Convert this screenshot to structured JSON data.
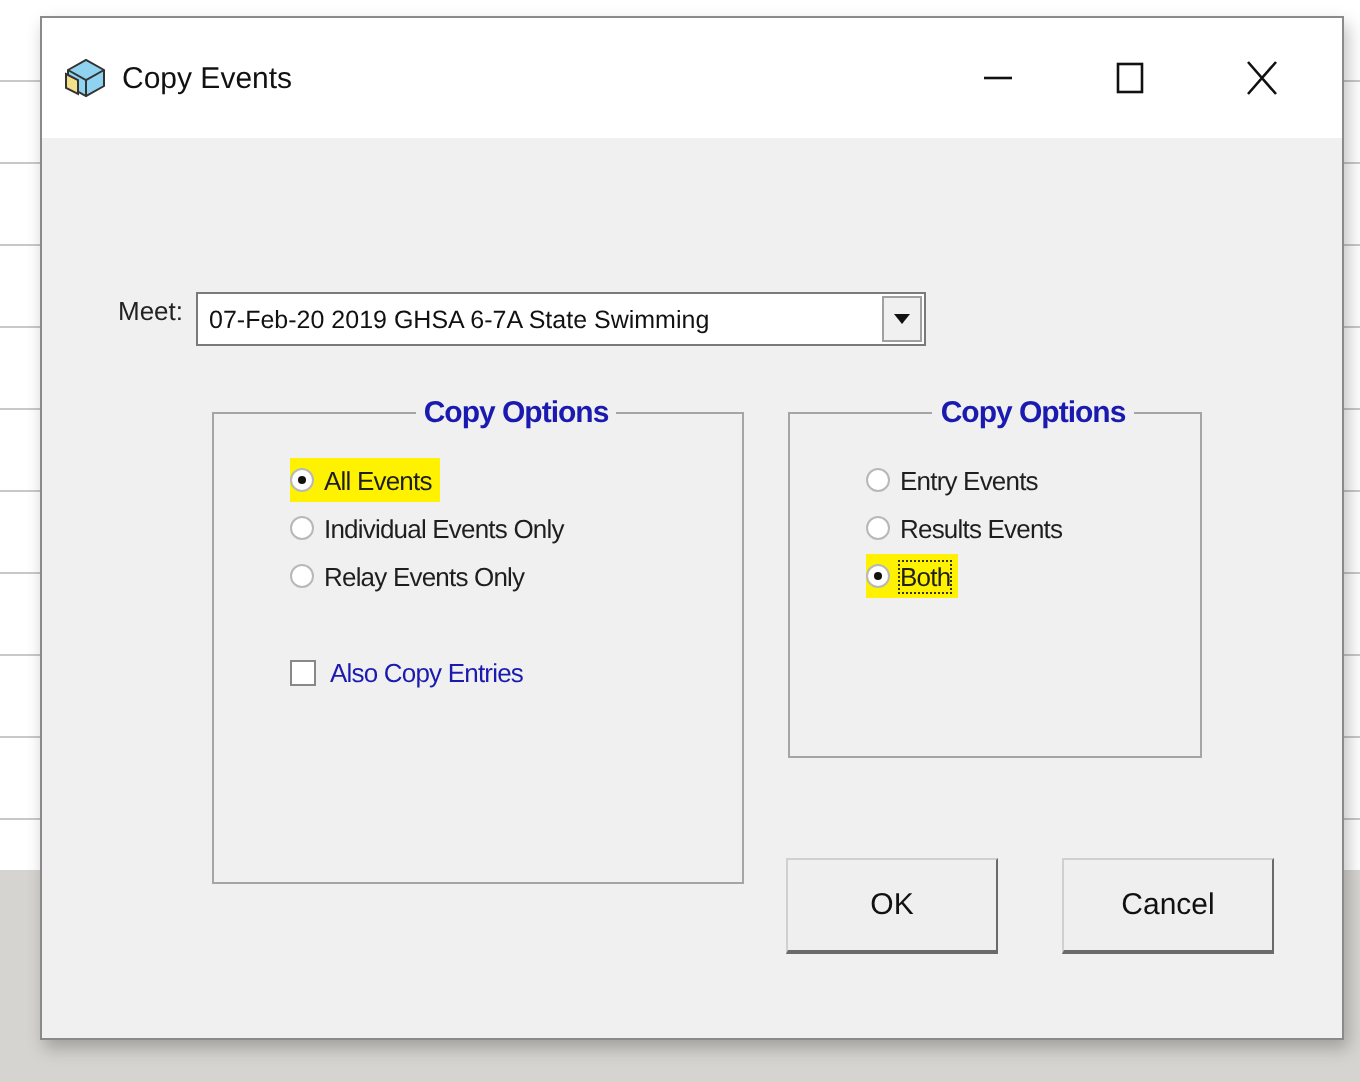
{
  "window": {
    "title": "Copy Events"
  },
  "meet": {
    "label": "Meet:",
    "value": "07-Feb-20 2019 GHSA 6-7A State Swimming"
  },
  "groups": [
    {
      "title": "Copy Options",
      "options": [
        {
          "label": "All Events",
          "selected": true,
          "highlighted": true
        },
        {
          "label": "Individual Events Only",
          "selected": false,
          "highlighted": false
        },
        {
          "label": "Relay Events Only",
          "selected": false,
          "highlighted": false
        }
      ],
      "checkbox": {
        "label": "Also Copy Entries",
        "checked": false
      }
    },
    {
      "title": "Copy Options",
      "options": [
        {
          "label": "Entry Events",
          "selected": false,
          "highlighted": false
        },
        {
          "label": "Results Events",
          "selected": false,
          "highlighted": false
        },
        {
          "label": "Both",
          "selected": true,
          "highlighted": true,
          "focused": true
        }
      ]
    }
  ],
  "buttons": [
    "OK",
    "Cancel"
  ]
}
